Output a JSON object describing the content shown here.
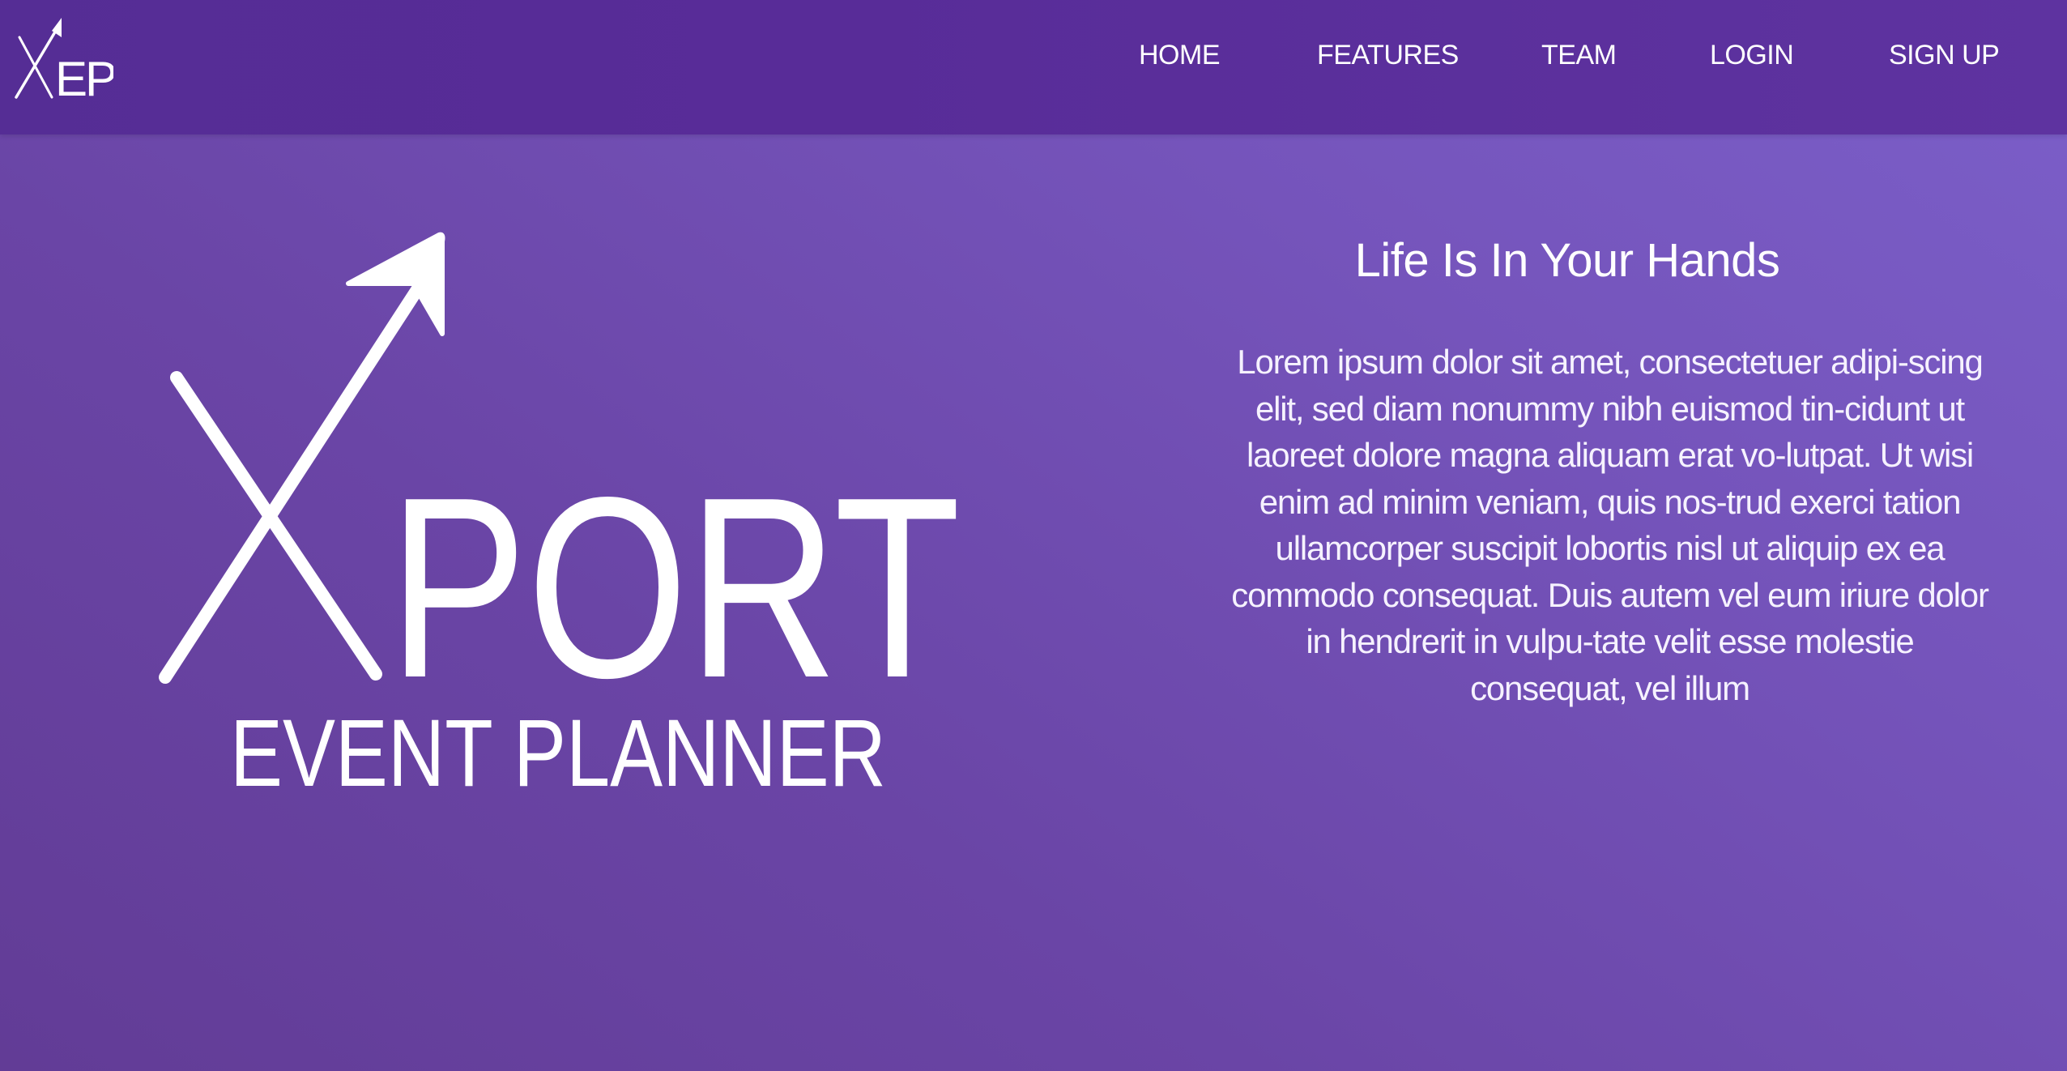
{
  "brand": {
    "nav_logo_text": "XEP",
    "hero_logo_text": "XPORT",
    "hero_logo_subtitle": "EVENT PLANNER"
  },
  "nav": {
    "items": [
      {
        "label": "HOME"
      },
      {
        "label": "FEATURES"
      },
      {
        "label": "TEAM"
      },
      {
        "label": "LOGIN"
      },
      {
        "label": "SIGN UP"
      }
    ]
  },
  "hero": {
    "tagline": "Life Is In Your Hands",
    "description": "Lorem ipsum dolor sit amet, consectetuer adipi-scing elit, sed diam nonummy nibh euismod tin-cidunt ut laoreet dolore magna aliquam erat vo-lutpat. Ut wisi enim ad minim veniam, quis nos-trud exerci tation ullamcorper suscipit lobortis nisl ut aliquip ex ea commodo consequat. Duis autem vel eum iriure dolor in hendrerit in vulpu-tate velit esse molestie consequat, vel illum"
  },
  "colors": {
    "navbar": "#572c97",
    "background_start": "#623c96",
    "background_end": "#7b5fc9",
    "text": "#ffffff"
  },
  "icons": {
    "logo_mark": "arrow-x-icon"
  }
}
